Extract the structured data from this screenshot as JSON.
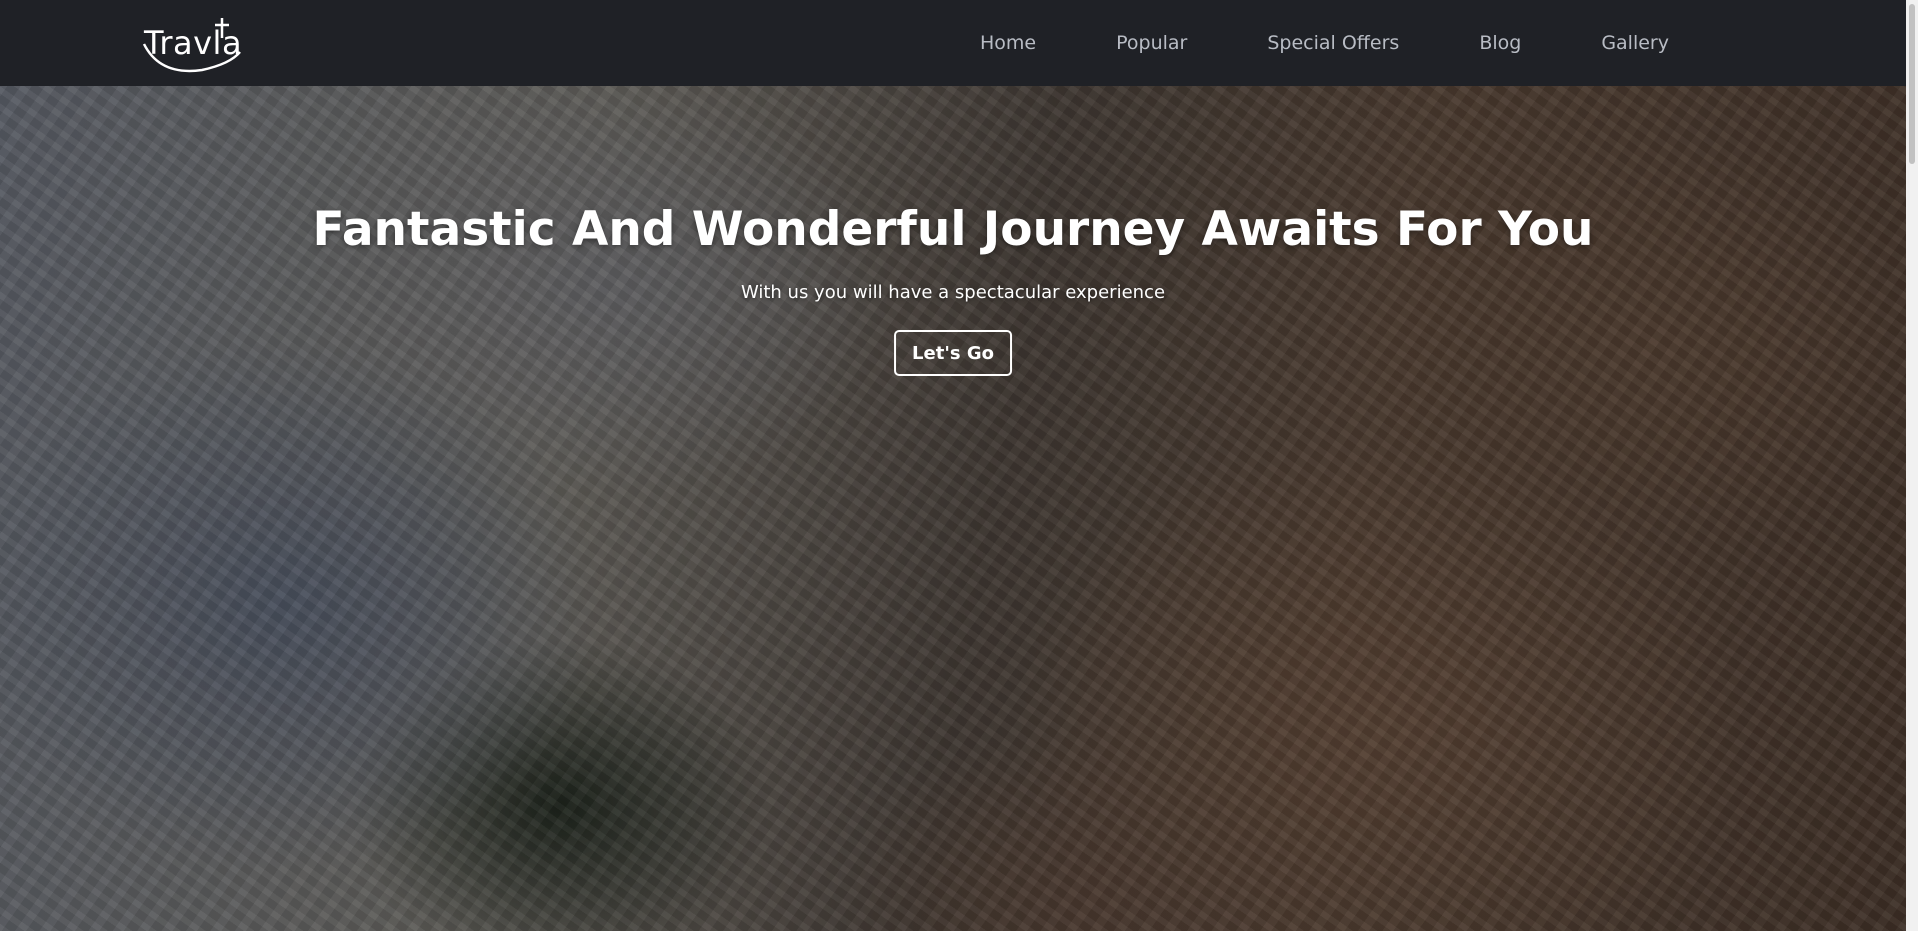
{
  "logo": {
    "text": "Travla"
  },
  "nav": {
    "links": [
      "Home",
      "Popular",
      "Special Offers",
      "Blog",
      "Gallery"
    ]
  },
  "hero": {
    "title": "Fantastic And Wonderful Journey Awaits For You",
    "subtitle": "With us you will have a spectacular experience",
    "cta_label": "Let's Go"
  },
  "colors": {
    "navbar_bg": "#1f2126",
    "nav_text": "#b8bcc4",
    "hero_text": "#ffffff"
  }
}
